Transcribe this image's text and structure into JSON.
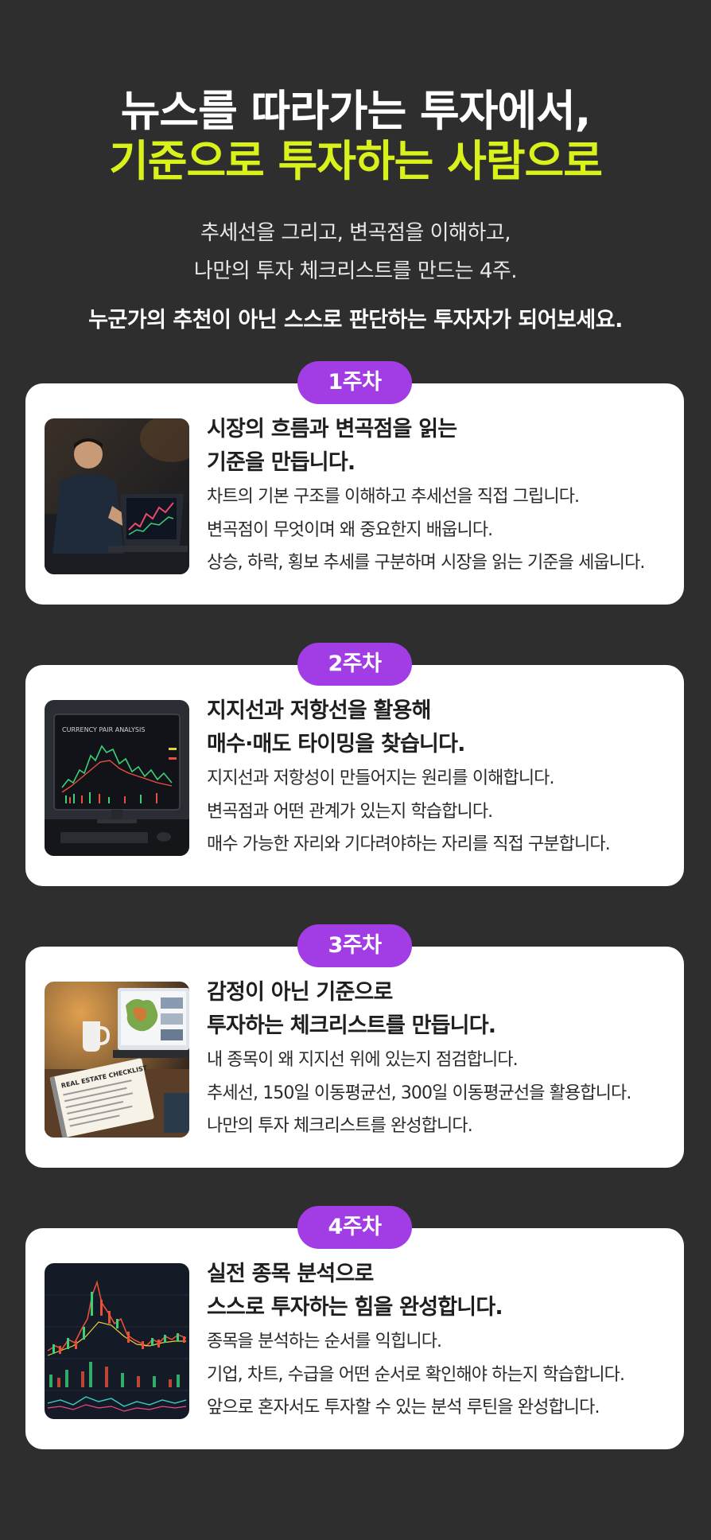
{
  "hero": {
    "line1": "뉴스를 따라가는 투자에서,",
    "line2": "기준으로 투자하는 사람으로",
    "sub1": "추세선을 그리고, 변곡점을 이해하고,",
    "sub2": "나만의 투자 체크리스트를 만드는 4주.",
    "sub3": "누군가의 추천이 아닌 스스로 판단하는 투자자가 되어보세요."
  },
  "colors": {
    "background": "#2e2e2e",
    "highlight": "#d9f21b",
    "badge": "#a23de6",
    "card": "#ffffff"
  },
  "weeks": [
    {
      "badge": "1주차",
      "title1": "시장의 흐름과 변곡점을 읽는",
      "title2": "기준을 만듭니다.",
      "desc1": "차트의 기본 구조를 이해하고 추세선을 직접 그립니다.",
      "desc2": "변곡점이 무엇이며 왜 중요한지 배웁니다.",
      "desc3": "상승, 하락, 횡보 추세를 구분하며 시장을 읽는 기준을 세웁니다."
    },
    {
      "badge": "2주차",
      "title1": "지지선과 저항선을 활용해",
      "title2": "매수·매도 타이밍을 찾습니다.",
      "desc1": "지지선과 저항성이 만들어지는 원리를 이해합니다.",
      "desc2": "변곡점과 어떤 관계가 있는지 학습합니다.",
      "desc3": "매수 가능한 자리와 기다려야하는 자리를 직접 구분합니다.",
      "screen_text": "CURRENCY PAIR ANALYSIS"
    },
    {
      "badge": "3주차",
      "title1": "감정이 아닌 기준으로",
      "title2": "투자하는 체크리스트를 만듭니다.",
      "desc1": "내 종목이 왜 지지선 위에 있는지 점검합니다.",
      "desc2": "추세선, 150일 이동평균선, 300일 이동평균선을 활용합니다.",
      "desc3": "나만의 투자 체크리스트를 완성합니다.",
      "notebook_text": "REAL ESTATE CHECKLIST"
    },
    {
      "badge": "4주차",
      "title1": "실전 종목 분석으로",
      "title2": "스스로 투자하는 힘을 완성합니다.",
      "desc1": "종목을 분석하는 순서를 익힙니다.",
      "desc2": "기업, 차트, 수급을 어떤 순서로 확인해야 하는지 학습합니다.",
      "desc3": "앞으로 혼자서도 투자할 수 있는 분석 루틴을 완성합니다."
    }
  ]
}
